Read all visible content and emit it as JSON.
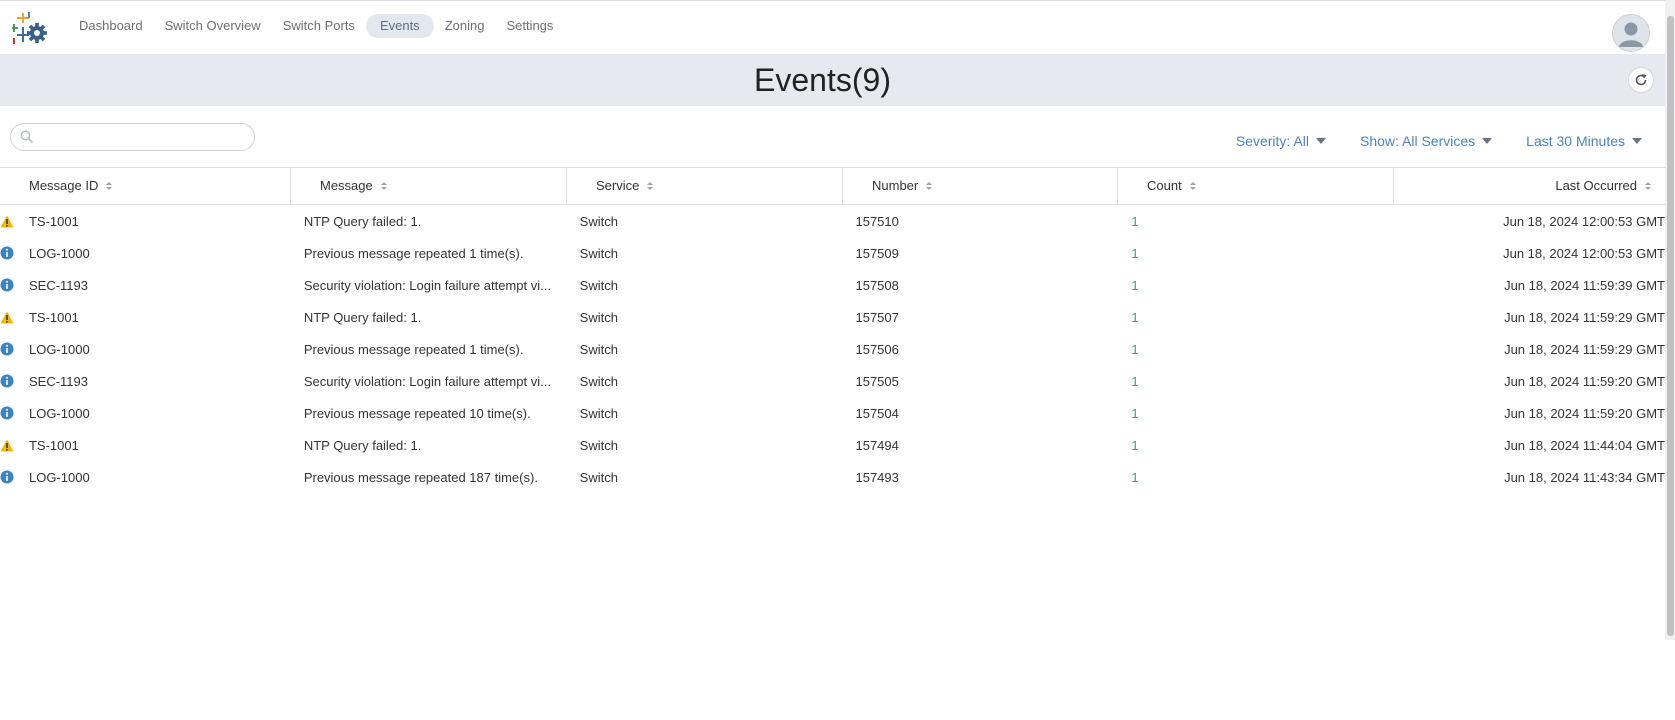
{
  "nav": {
    "items": [
      {
        "label": "Dashboard"
      },
      {
        "label": "Switch Overview"
      },
      {
        "label": "Switch Ports"
      },
      {
        "label": "Events",
        "active": true
      },
      {
        "label": "Zoning"
      },
      {
        "label": "Settings"
      }
    ]
  },
  "page": {
    "title": "Events(9)"
  },
  "search": {
    "value": "",
    "placeholder": ""
  },
  "filters": {
    "severity": "Severity: All",
    "show": "Show: All Services",
    "time": "Last 30 Minutes"
  },
  "table": {
    "columns": [
      "Message ID",
      "Message",
      "Service",
      "Number",
      "Count",
      "Last Occurred"
    ],
    "rows": [
      {
        "severity": "warning",
        "id": "TS-1001",
        "message": "NTP Query failed: 1.",
        "service": "Switch",
        "number": "157510",
        "count": "1",
        "last": "Jun 18, 2024 12:00:53 GMT"
      },
      {
        "severity": "info",
        "id": "LOG-1000",
        "message": "Previous message repeated 1 time(s).",
        "service": "Switch",
        "number": "157509",
        "count": "1",
        "last": "Jun 18, 2024 12:00:53 GMT"
      },
      {
        "severity": "info",
        "id": "SEC-1193",
        "message": "Security violation: Login failure attempt vi...",
        "service": "Switch",
        "number": "157508",
        "count": "1",
        "last": "Jun 18, 2024 11:59:39 GMT"
      },
      {
        "severity": "warning",
        "id": "TS-1001",
        "message": "NTP Query failed: 1.",
        "service": "Switch",
        "number": "157507",
        "count": "1",
        "last": "Jun 18, 2024 11:59:29 GMT"
      },
      {
        "severity": "info",
        "id": "LOG-1000",
        "message": "Previous message repeated 1 time(s).",
        "service": "Switch",
        "number": "157506",
        "count": "1",
        "last": "Jun 18, 2024 11:59:29 GMT"
      },
      {
        "severity": "info",
        "id": "SEC-1193",
        "message": "Security violation: Login failure attempt vi...",
        "service": "Switch",
        "number": "157505",
        "count": "1",
        "last": "Jun 18, 2024 11:59:20 GMT"
      },
      {
        "severity": "info",
        "id": "LOG-1000",
        "message": "Previous message repeated 10 time(s).",
        "service": "Switch",
        "number": "157504",
        "count": "1",
        "last": "Jun 18, 2024 11:59:20 GMT"
      },
      {
        "severity": "warning",
        "id": "TS-1001",
        "message": "NTP Query failed: 1.",
        "service": "Switch",
        "number": "157494",
        "count": "1",
        "last": "Jun 18, 2024 11:44:04 GMT"
      },
      {
        "severity": "info",
        "id": "LOG-1000",
        "message": "Previous message repeated 187 time(s).",
        "service": "Switch",
        "number": "157493",
        "count": "1",
        "last": "Jun 18, 2024 11:43:34 GMT"
      }
    ]
  },
  "colors": {
    "accent": "#4f83b7",
    "warning": "#f2b705",
    "info": "#3d82c4",
    "count": "#4a9a5c",
    "title_bar": "#e6eaf0"
  },
  "icons": {
    "logo": "settings-gear-logo-icon",
    "refresh": "refresh-icon",
    "search": "search-icon",
    "avatar": "user-avatar-icon",
    "warning": "warning-icon",
    "info": "info-icon"
  }
}
